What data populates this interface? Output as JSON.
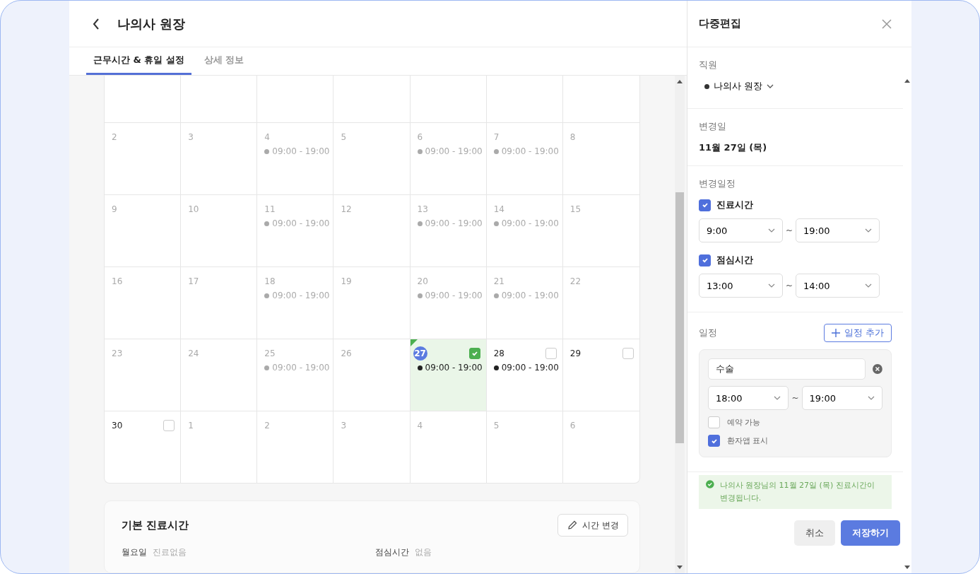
{
  "header": {
    "title": "나의사 원장"
  },
  "tabs": [
    {
      "label": "근무시간 & 휴일 설정",
      "selected": true
    },
    {
      "label": "상세 정보",
      "selected": false
    }
  ],
  "calendar": {
    "weeks": [
      [
        {
          "day": "2",
          "kind": "locked",
          "selected": false
        },
        {
          "day": "3",
          "kind": "locked",
          "selected": false
        },
        {
          "day": "4",
          "kind": "locked",
          "selected": false,
          "hours": "09:00 - 19:00"
        },
        {
          "day": "5",
          "kind": "locked",
          "selected": false
        },
        {
          "day": "6",
          "kind": "locked",
          "selected": false,
          "hours": "09:00 - 19:00"
        },
        {
          "day": "7",
          "kind": "locked",
          "selected": false,
          "hours": "09:00 - 19:00"
        },
        {
          "day": "8",
          "kind": "locked",
          "selected": false
        }
      ],
      [
        {
          "day": "9",
          "kind": "locked",
          "selected": false
        },
        {
          "day": "10",
          "kind": "locked",
          "selected": false
        },
        {
          "day": "11",
          "kind": "locked",
          "selected": false,
          "hours": "09:00 - 19:00"
        },
        {
          "day": "12",
          "kind": "locked",
          "selected": false
        },
        {
          "day": "13",
          "kind": "locked",
          "selected": false,
          "hours": "09:00 - 19:00"
        },
        {
          "day": "14",
          "kind": "locked",
          "selected": false,
          "hours": "09:00 - 19:00"
        },
        {
          "day": "15",
          "kind": "locked",
          "selected": false
        }
      ],
      [
        {
          "day": "16",
          "kind": "locked",
          "selected": false
        },
        {
          "day": "17",
          "kind": "locked",
          "selected": false
        },
        {
          "day": "18",
          "kind": "locked",
          "selected": false,
          "hours": "09:00 - 19:00"
        },
        {
          "day": "19",
          "kind": "locked",
          "selected": false
        },
        {
          "day": "20",
          "kind": "locked",
          "selected": false,
          "hours": "09:00 - 19:00"
        },
        {
          "day": "21",
          "kind": "locked",
          "selected": false,
          "hours": "09:00 - 19:00"
        },
        {
          "day": "22",
          "kind": "locked",
          "selected": false
        }
      ],
      [
        {
          "day": "23",
          "kind": "locked",
          "selected": false
        },
        {
          "day": "24",
          "kind": "locked",
          "selected": false
        },
        {
          "day": "25",
          "kind": "locked",
          "selected": false,
          "hours": "09:00 - 19:00"
        },
        {
          "day": "26",
          "kind": "locked",
          "selected": false
        },
        {
          "day": "27",
          "kind": "editable",
          "selected": true,
          "checked": true,
          "hours": "09:00 - 19:00"
        },
        {
          "day": "28",
          "kind": "editable",
          "selected": false,
          "checked": false,
          "hours": "09:00 - 19:00"
        },
        {
          "day": "29",
          "kind": "editable",
          "selected": false,
          "checked": false
        }
      ],
      [
        {
          "day": "30",
          "kind": "editable",
          "selected": false,
          "checked": false
        },
        {
          "day": "1",
          "kind": "locked",
          "selected": false
        },
        {
          "day": "2",
          "kind": "locked",
          "selected": false
        },
        {
          "day": "3",
          "kind": "locked",
          "selected": false
        },
        {
          "day": "4",
          "kind": "locked",
          "selected": false
        },
        {
          "day": "5",
          "kind": "locked",
          "selected": false
        },
        {
          "day": "6",
          "kind": "locked",
          "selected": false
        }
      ]
    ]
  },
  "basic_hours": {
    "title": "기본 진료시간",
    "button": "시간 변경",
    "rows": [
      {
        "label": "월요일",
        "value": "진료없음"
      },
      {
        "label": "점심시간",
        "value": "없음"
      }
    ]
  },
  "panel": {
    "title": "다중편집",
    "staff": {
      "label": "직원",
      "value": "나의사 원장"
    },
    "change_date": {
      "label": "변경일",
      "value": "11월 27일 (목)"
    },
    "schedule_change": {
      "label": "변경일정",
      "groups": [
        {
          "label": "진료시간",
          "checked": true,
          "from": "9:00",
          "sep": "~",
          "to": "19:00"
        },
        {
          "label": "점심시간",
          "checked": true,
          "from": "13:00",
          "sep": "~",
          "to": "14:00"
        }
      ]
    },
    "events": {
      "label": "일정",
      "add_button": "일정 추가",
      "items": [
        {
          "name": "수술",
          "from": "18:00",
          "sep": "~",
          "to": "19:00",
          "options": [
            {
              "label": "예약 가능",
              "checked": false
            },
            {
              "label": "환자앱 표시",
              "checked": true
            }
          ]
        }
      ]
    },
    "notice": "나의사 원장님의 11월 27일 (목) 진료시간이 변경됩니다.",
    "buttons": {
      "cancel": "취소",
      "save": "저장하기"
    }
  }
}
